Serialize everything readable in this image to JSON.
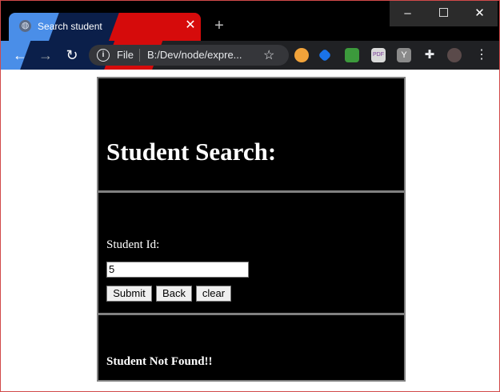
{
  "browser": {
    "tab_title": "Search student",
    "tab_close": "✕",
    "new_tab": "+",
    "window_controls": {
      "minimize": "–",
      "maximize": "☐",
      "close": "✕"
    },
    "nav": {
      "back": "←",
      "forward": "→",
      "reload": "↻"
    },
    "omnibox": {
      "info": "i",
      "scheme_label": "File",
      "url": "B:/Dev/node/expre...",
      "star": "☆"
    },
    "extensions": [
      "Y",
      "…"
    ]
  },
  "page": {
    "heading": "Student Search:",
    "form": {
      "label": "Student Id:",
      "input_value": "5",
      "buttons": {
        "submit": "Submit",
        "back": "Back",
        "clear": "clear"
      }
    },
    "result": "Student Not Found!!"
  }
}
